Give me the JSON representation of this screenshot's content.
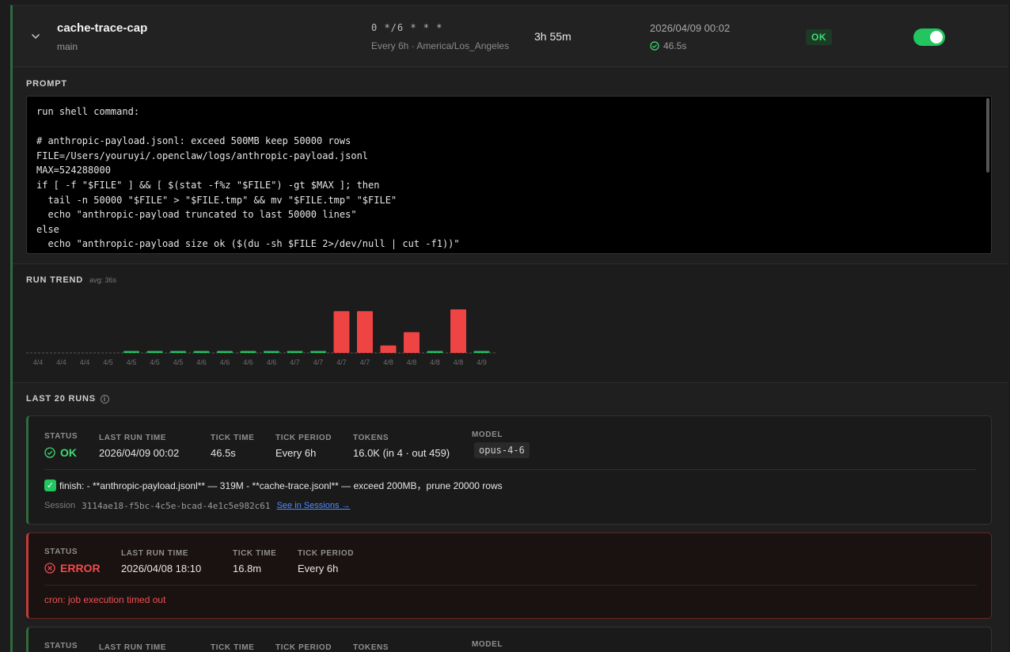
{
  "job": {
    "name": "cache-trace-cap",
    "branch": "main",
    "cron": "0 */6 * * *",
    "schedule_desc": "Every 6h · America/Los_Angeles",
    "next_in": "3h 55m",
    "last_run_time": "2026/04/09 00:02",
    "last_duration": "46.5s",
    "status_badge": "OK",
    "enabled": true
  },
  "prompt": {
    "label": "PROMPT",
    "text": "run shell command:\n\n# anthropic-payload.jsonl: exceed 500MB keep 50000 rows\nFILE=/Users/youruyi/.openclaw/logs/anthropic-payload.jsonl\nMAX=524288000\nif [ -f \"$FILE\" ] && [ $(stat -f%z \"$FILE\") -gt $MAX ]; then\n  tail -n 50000 \"$FILE\" > \"$FILE.tmp\" && mv \"$FILE.tmp\" \"$FILE\"\n  echo \"anthropic-payload truncated to last 50000 lines\"\nelse\n  echo \"anthropic-payload size ok ($(du -sh $FILE 2>/dev/null | cut -f1))\""
  },
  "trend": {
    "label": "RUN TREND",
    "avg": "avg: 36s"
  },
  "chart_data": {
    "type": "bar",
    "categories": [
      "4/4",
      "4/4",
      "4/4",
      "4/5",
      "4/5",
      "4/5",
      "4/5",
      "4/6",
      "4/6",
      "4/6",
      "4/6",
      "4/7",
      "4/7",
      "4/7",
      "4/7",
      "4/8",
      "4/8",
      "4/8",
      "4/8",
      "4/9"
    ],
    "values": [
      0,
      0,
      0,
      0,
      46,
      46,
      46,
      46,
      46,
      46,
      46,
      46,
      46,
      1008,
      1008,
      180,
      500,
      46,
      1050,
      46
    ],
    "status": [
      "ok",
      "ok",
      "ok",
      "ok",
      "ok",
      "ok",
      "ok",
      "ok",
      "ok",
      "ok",
      "ok",
      "ok",
      "ok",
      "error",
      "error",
      "error",
      "error",
      "ok",
      "error",
      "ok"
    ],
    "avg_seconds": 36,
    "colors": {
      "ok": "#22c55e",
      "error": "#ef4444",
      "baseline": "#555555"
    }
  },
  "runs": {
    "label": "LAST 20 RUNS",
    "labels": {
      "status": "STATUS",
      "last_run_time": "LAST RUN TIME",
      "tick_time": "TICK TIME",
      "tick_period": "TICK PERIOD",
      "tokens": "TOKENS",
      "model": "MODEL"
    },
    "items": [
      {
        "status": "OK",
        "last_run_time": "2026/04/09 00:02",
        "tick_time": "46.5s",
        "tick_period": "Every 6h",
        "tokens": "16.0K (in 4 · out 459)",
        "model": "opus-4-6",
        "finish": "finish:  - **anthropic-payload.jsonl** — 319M - **cache-trace.jsonl** — exceed 200MB，prune 20000 rows",
        "session_label": "Session",
        "session_id": "3114ae18-f5bc-4c5e-bcad-4e1c5e982c61",
        "session_link": "See in Sessions →"
      },
      {
        "status": "ERROR",
        "last_run_time": "2026/04/08 18:10",
        "tick_time": "16.8m",
        "tick_period": "Every 6h",
        "error": "cron: job execution timed out"
      }
    ]
  }
}
